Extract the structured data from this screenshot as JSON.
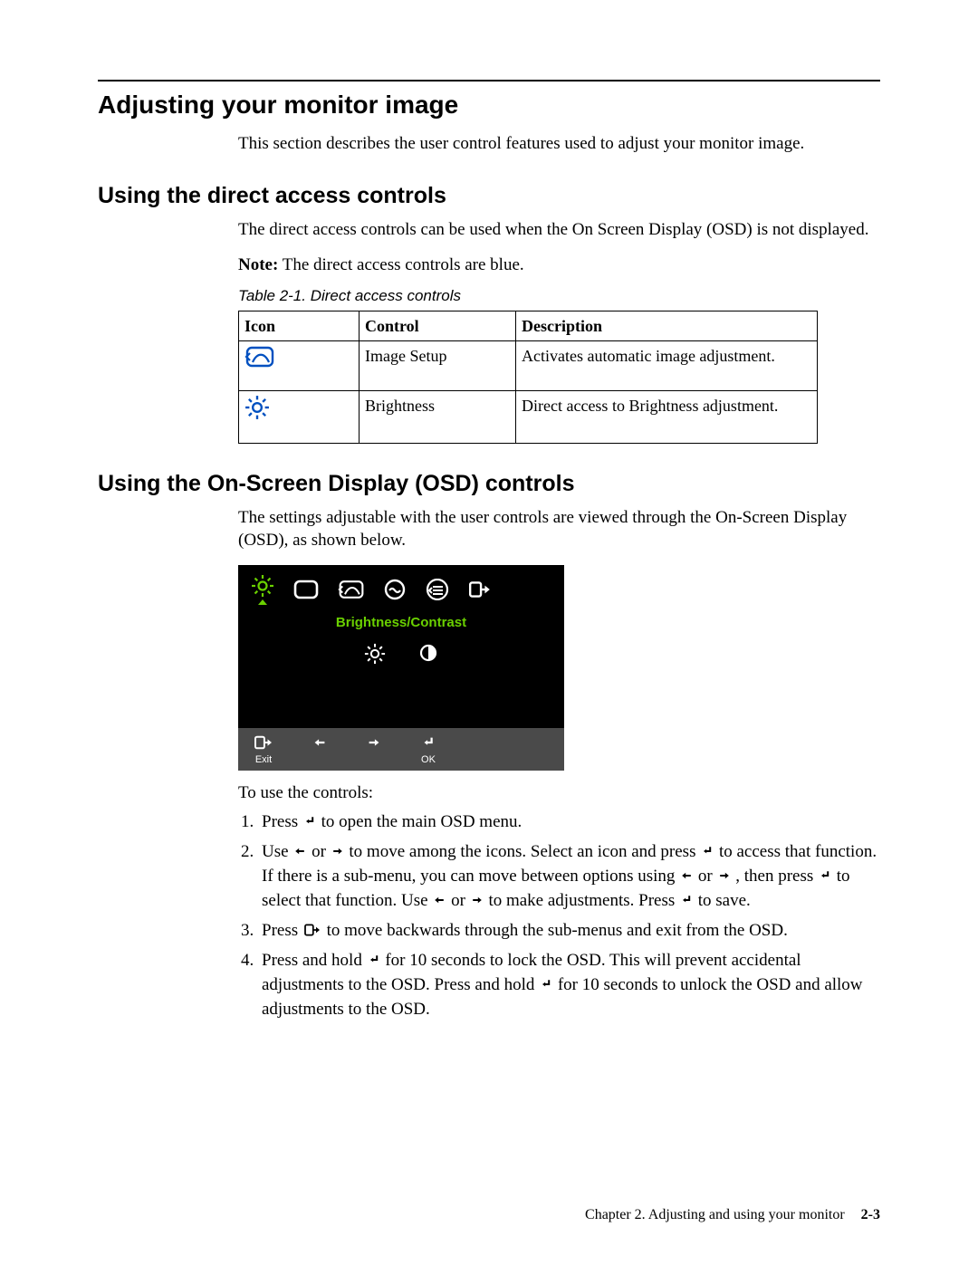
{
  "heading_main": "Adjusting your monitor image",
  "intro_main": "This section describes the user control features used to adjust your monitor image.",
  "section_direct": {
    "heading": "Using the direct access controls",
    "para": "The direct access controls can be used when the On Screen Display (OSD) is not displayed.",
    "note_label": "Note:",
    "note_text": " The direct access controls are blue.",
    "table_caption": "Table 2-1. Direct access controls",
    "headers": {
      "icon": "Icon",
      "control": "Control",
      "description": "Description"
    },
    "rows": [
      {
        "icon": "image-setup-icon",
        "control": "Image Setup",
        "description": "Activates automatic image adjustment."
      },
      {
        "icon": "brightness-icon",
        "control": "Brightness",
        "description": "Direct access to Brightness adjustment."
      }
    ]
  },
  "section_osd": {
    "heading": "Using the On-Screen Display (OSD) controls",
    "para": "The settings adjustable with the user controls are viewed through the On-Screen Display (OSD), as shown below.",
    "menu_label": "Brightness/Contrast",
    "bottom_exit": "Exit",
    "bottom_ok": "OK",
    "instr_intro": "To use the controls:",
    "steps": {
      "s1a": "Press ",
      "s1b": " to open the main OSD menu.",
      "s2a": "Use ",
      "s2b": " or ",
      "s2c": " to move among the icons. Select an icon and press ",
      "s2d": " to access that function. If there is a sub-menu, you can move between options using ",
      "s2e": " or ",
      "s2f": " , then press ",
      "s2g": " to select that function. Use ",
      "s2h": " or ",
      "s2i": " to make adjustments. Press ",
      "s2j": " to save.",
      "s3a": "Press ",
      "s3b": " to move backwards through the sub-menus and exit from the OSD.",
      "s4a": "Press and hold ",
      "s4b": " for 10 seconds to lock the OSD. This will prevent accidental adjustments to the OSD. Press and hold ",
      "s4c": " for 10 seconds to unlock the OSD and allow adjustments to the OSD."
    }
  },
  "footer_chapter": "Chapter 2. Adjusting and using your monitor",
  "footer_page": "2-3"
}
